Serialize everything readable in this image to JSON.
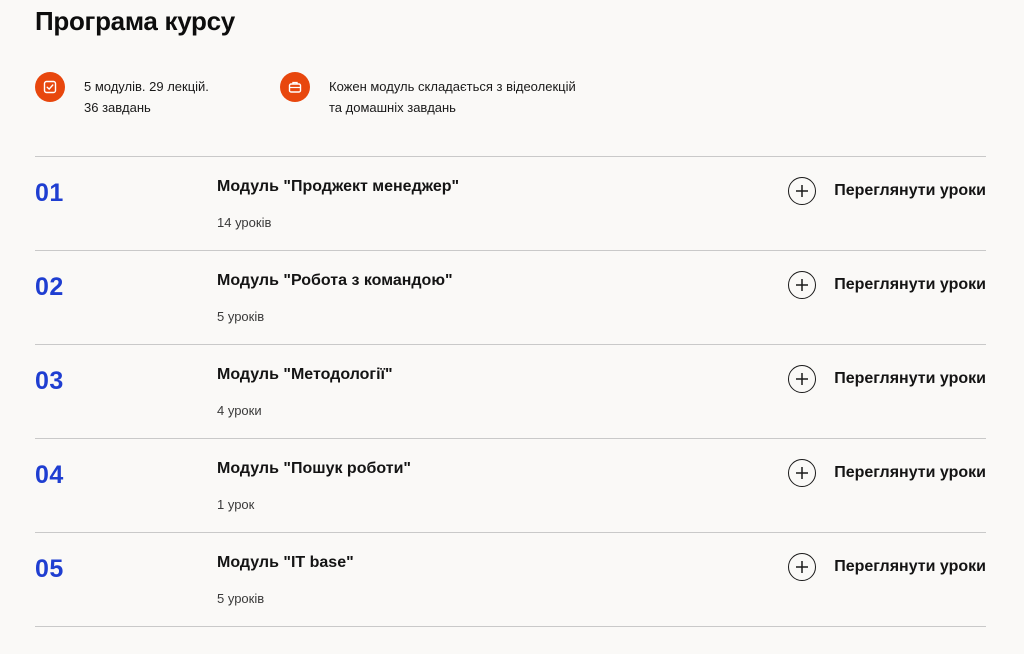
{
  "page_title": "Програма курсу",
  "summary": {
    "stats": {
      "line1": "5 модулів. 29 лекцій.",
      "line2": "36 завдань",
      "icon": "checkbox-icon"
    },
    "format": {
      "line1": "Кожен модуль складається з відеолекцій",
      "line2": "та домашніх завдань",
      "icon": "briefcase-icon"
    },
    "accent_color": "#e8470d"
  },
  "modules": [
    {
      "number": "01",
      "title": "Модуль \"Проджект менеджер\"",
      "lessons": "14 уроків",
      "action_label": "Переглянути уроки"
    },
    {
      "number": "02",
      "title": "Модуль \"Робота з командою\"",
      "lessons": "5 уроків",
      "action_label": "Переглянути уроки"
    },
    {
      "number": "03",
      "title": "Модуль \"Методології\"",
      "lessons": "4 уроки",
      "action_label": "Переглянути уроки"
    },
    {
      "number": "04",
      "title": "Модуль \"Пошук роботи\"",
      "lessons": "1 урок",
      "action_label": "Переглянути уроки"
    },
    {
      "number": "05",
      "title": "Модуль \"IT base\"",
      "lessons": "5 уроків",
      "action_label": "Переглянути уроки"
    }
  ],
  "number_color": "#1f3ed1"
}
